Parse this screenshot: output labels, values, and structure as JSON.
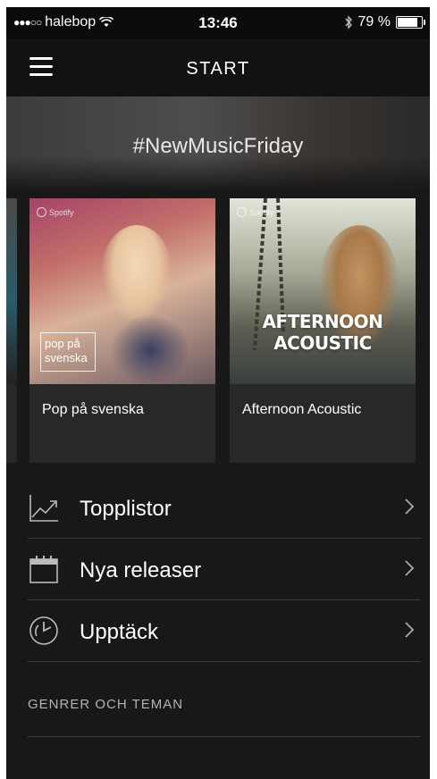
{
  "status_bar": {
    "signal": "●●●○○",
    "carrier": "halebop",
    "time": "13:46",
    "battery_percent": "79 %",
    "battery_level": 0.79
  },
  "nav": {
    "title": "START"
  },
  "hero": {
    "title": "#NewMusicFriday"
  },
  "cards": [
    {
      "label": "Pop på svenska",
      "logo": "Spotify",
      "overlay": "pop på svenska"
    },
    {
      "label": "Afternoon Acoustic",
      "logo": "Spotify",
      "overlay": "AFTERNOON ACOUSTIC"
    }
  ],
  "menu": {
    "items": [
      {
        "label": "Topplistor",
        "icon": "chart-icon"
      },
      {
        "label": "Nya releaser",
        "icon": "calendar-icon"
      },
      {
        "label": "Upptäck",
        "icon": "discover-icon"
      }
    ]
  },
  "section": {
    "title": "GENRER OCH TEMAN"
  }
}
